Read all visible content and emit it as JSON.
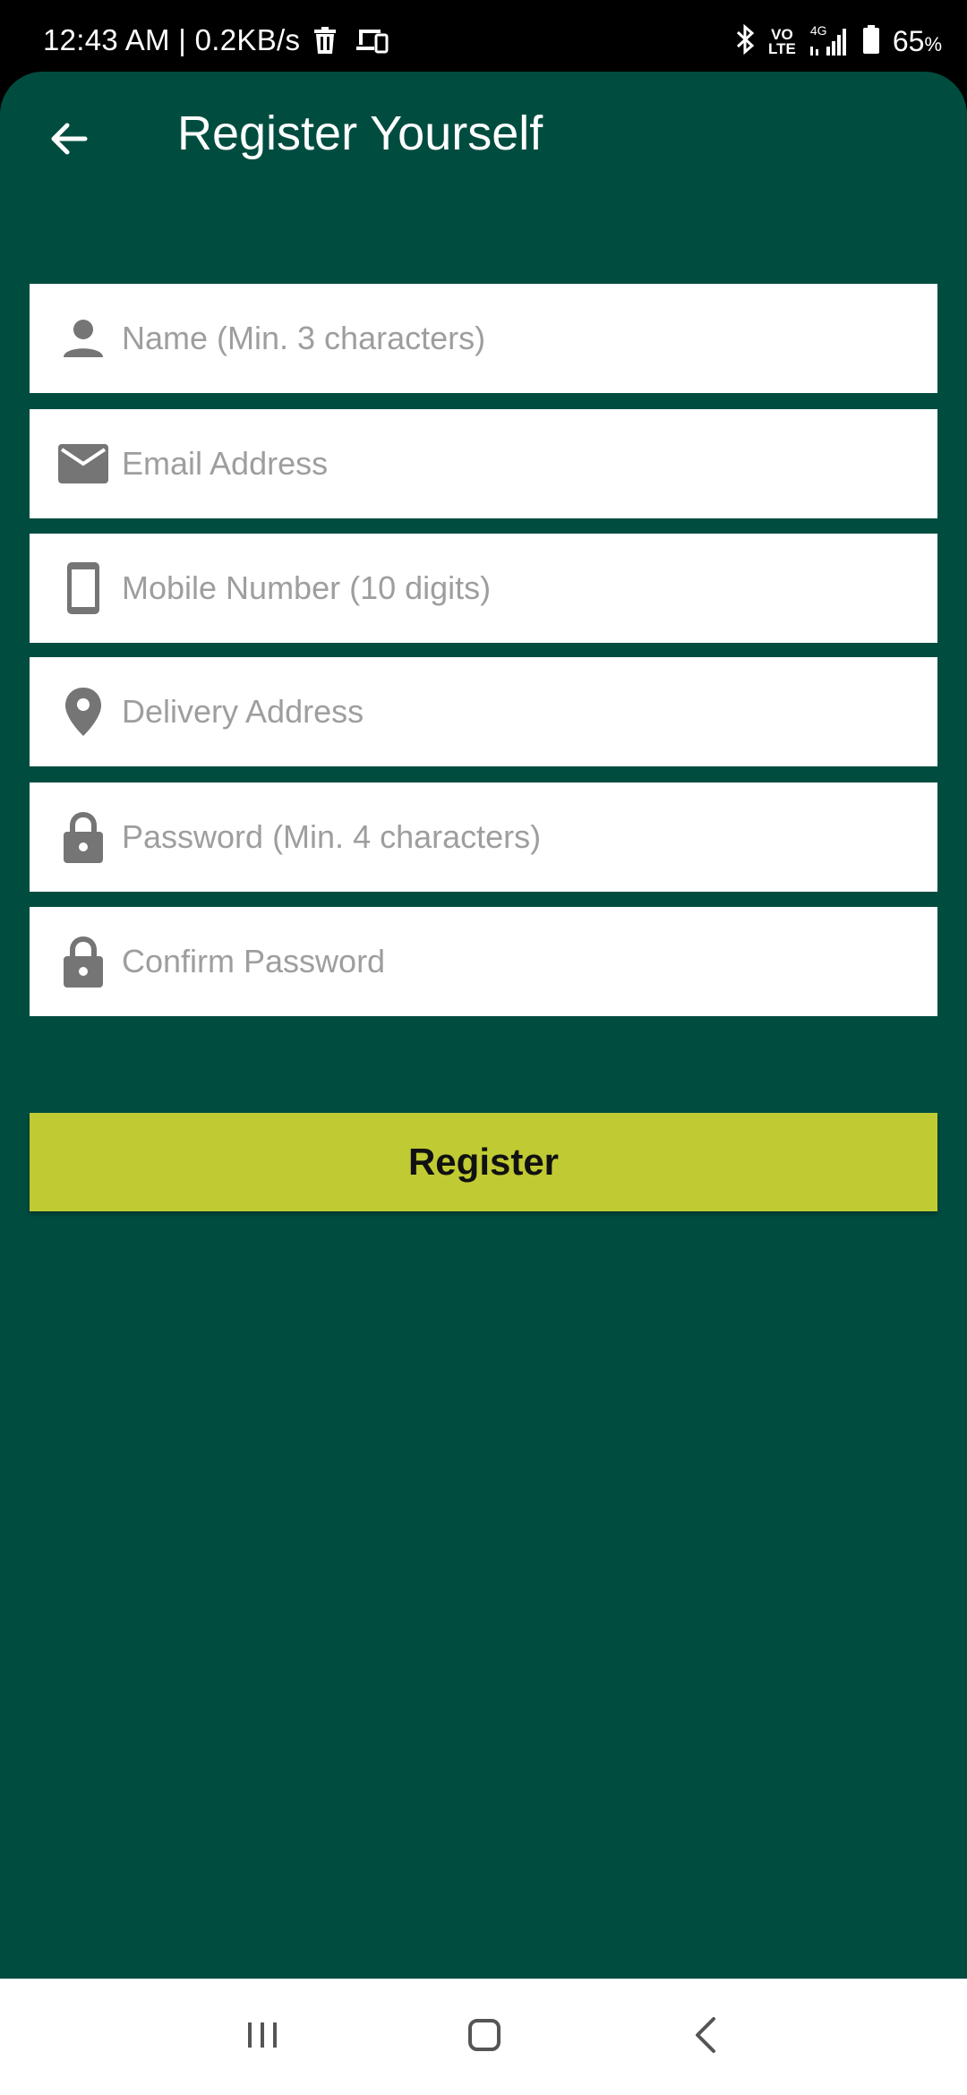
{
  "status_bar": {
    "time": "12:43 AM | 0.2KB/s",
    "network_label_top": "VO",
    "network_label_bottom": "LTE",
    "signal_label": "4G",
    "battery_percent": "65",
    "battery_unit": "%"
  },
  "header": {
    "title": "Register Yourself",
    "back_icon": "arrow-left-icon"
  },
  "form": {
    "fields": [
      {
        "icon": "person-icon",
        "placeholder": "Name (Min. 3 characters)"
      },
      {
        "icon": "mail-icon",
        "placeholder": "Email Address"
      },
      {
        "icon": "phone-icon",
        "placeholder": "Mobile Number (10 digits)"
      },
      {
        "icon": "location-pin-icon",
        "placeholder": "Delivery Address"
      },
      {
        "icon": "lock-icon",
        "placeholder": "Password (Min. 4 characters)"
      },
      {
        "icon": "lock-icon",
        "placeholder": "Confirm Password"
      }
    ],
    "submit_label": "Register"
  },
  "colors": {
    "background": "#004d40",
    "accent": "#c0ca33",
    "field_background": "#ffffff",
    "placeholder": "#9e9e9e",
    "icon": "#757575"
  },
  "nav_bar": {
    "recents_icon": "recents-icon",
    "home_icon": "home-icon",
    "back_icon": "back-chevron-icon"
  }
}
